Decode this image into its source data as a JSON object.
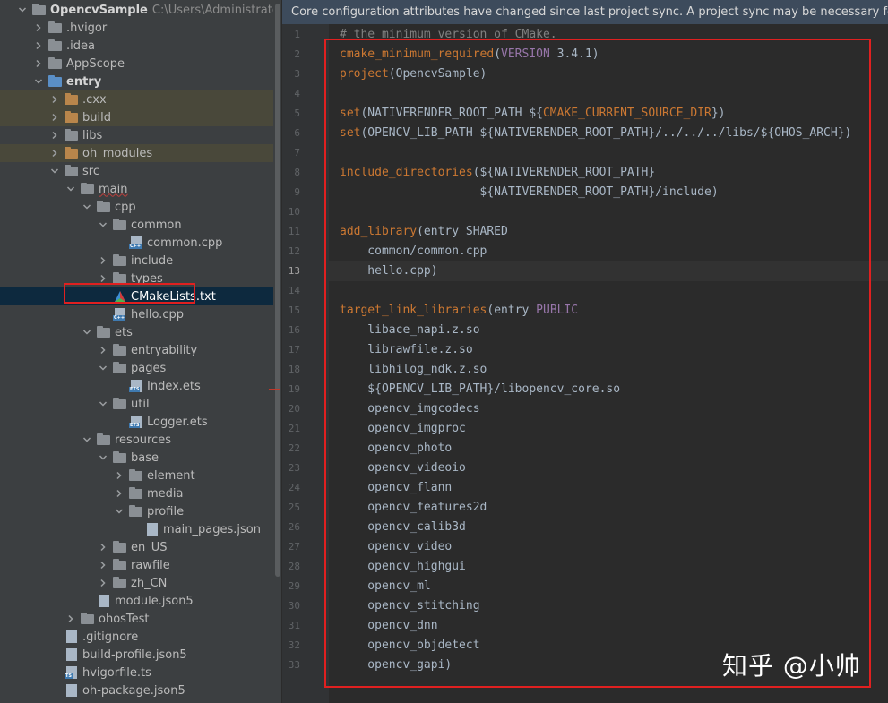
{
  "project_tree": {
    "rows": [
      {
        "label": "OpencvSample",
        "path": "C:\\Users\\Administrator\\DevEco",
        "bold": true,
        "chevron": "down",
        "icon": "folder",
        "indent": 0
      },
      {
        "label": ".hvigor",
        "chevron": "right",
        "icon": "folder",
        "indent": 1
      },
      {
        "label": ".idea",
        "chevron": "right",
        "icon": "folder",
        "indent": 1
      },
      {
        "label": "AppScope",
        "chevron": "right",
        "icon": "folder",
        "indent": 1
      },
      {
        "label": "entry",
        "bold": true,
        "chevron": "down",
        "icon": "folder-blue",
        "indent": 1
      },
      {
        "label": ".cxx",
        "chevron": "right",
        "icon": "folder-orange",
        "indent": 2,
        "excluded": true
      },
      {
        "label": "build",
        "chevron": "right",
        "icon": "folder-orange",
        "indent": 2,
        "excluded": true
      },
      {
        "label": "libs",
        "chevron": "right",
        "icon": "folder",
        "indent": 2
      },
      {
        "label": "oh_modules",
        "chevron": "right",
        "icon": "folder-orange",
        "indent": 2,
        "excluded": true
      },
      {
        "label": "src",
        "chevron": "down",
        "icon": "folder",
        "indent": 2
      },
      {
        "label": "main",
        "chevron": "down",
        "icon": "folder",
        "indent": 3,
        "squiggle": true
      },
      {
        "label": "cpp",
        "chevron": "down",
        "icon": "folder",
        "indent": 4
      },
      {
        "label": "common",
        "chevron": "down",
        "icon": "folder",
        "indent": 5
      },
      {
        "label": "common.cpp",
        "chevron": "none",
        "icon": "file-cpp",
        "indent": 6
      },
      {
        "label": "include",
        "chevron": "right",
        "icon": "folder",
        "indent": 5
      },
      {
        "label": "types",
        "chevron": "right",
        "icon": "folder",
        "indent": 5
      },
      {
        "label": "CMakeLists.txt",
        "chevron": "none",
        "icon": "file-cmake",
        "indent": 5,
        "selected": true
      },
      {
        "label": "hello.cpp",
        "chevron": "none",
        "icon": "file-cpp",
        "indent": 5
      },
      {
        "label": "ets",
        "chevron": "down",
        "icon": "folder",
        "indent": 4
      },
      {
        "label": "entryability",
        "chevron": "right",
        "icon": "folder",
        "indent": 5
      },
      {
        "label": "pages",
        "chevron": "down",
        "icon": "folder",
        "indent": 5
      },
      {
        "label": "Index.ets",
        "chevron": "none",
        "icon": "file-ets",
        "indent": 6
      },
      {
        "label": "util",
        "chevron": "down",
        "icon": "folder",
        "indent": 5
      },
      {
        "label": "Logger.ets",
        "chevron": "none",
        "icon": "file-ets",
        "indent": 6
      },
      {
        "label": "resources",
        "chevron": "down",
        "icon": "folder",
        "indent": 4
      },
      {
        "label": "base",
        "chevron": "down",
        "icon": "folder",
        "indent": 5
      },
      {
        "label": "element",
        "chevron": "right",
        "icon": "folder",
        "indent": 6
      },
      {
        "label": "media",
        "chevron": "right",
        "icon": "folder",
        "indent": 6
      },
      {
        "label": "profile",
        "chevron": "down",
        "icon": "folder",
        "indent": 6
      },
      {
        "label": "main_pages.json",
        "chevron": "none",
        "icon": "file-json",
        "indent": 7
      },
      {
        "label": "en_US",
        "chevron": "right",
        "icon": "folder",
        "indent": 5
      },
      {
        "label": "rawfile",
        "chevron": "right",
        "icon": "folder",
        "indent": 5
      },
      {
        "label": "zh_CN",
        "chevron": "right",
        "icon": "folder",
        "indent": 5
      },
      {
        "label": "module.json5",
        "chevron": "none",
        "icon": "file-json",
        "indent": 4
      },
      {
        "label": "ohosTest",
        "chevron": "right",
        "icon": "folder",
        "indent": 3
      },
      {
        "label": ".gitignore",
        "chevron": "none",
        "icon": "file-plain",
        "indent": 2
      },
      {
        "label": "build-profile.json5",
        "chevron": "none",
        "icon": "file-json",
        "indent": 2
      },
      {
        "label": "hvigorfile.ts",
        "chevron": "none",
        "icon": "file-ts",
        "indent": 2
      },
      {
        "label": "oh-package.json5",
        "chevron": "none",
        "icon": "file-json",
        "indent": 2
      }
    ]
  },
  "editor": {
    "banner": "Core configuration attributes have changed since last project sync. A project sync may be necessary for the IDE to",
    "current_line": 13,
    "lines": [
      [
        [
          "cmt",
          "# the minimum version of CMake."
        ]
      ],
      [
        [
          "fn",
          "cmake_minimum_required"
        ],
        [
          "pl",
          "("
        ],
        [
          "var",
          "VERSION"
        ],
        [
          "pl",
          " 3.4.1)"
        ]
      ],
      [
        [
          "fn",
          "project"
        ],
        [
          "pl",
          "(OpencvSample)"
        ]
      ],
      [],
      [
        [
          "fn",
          "set"
        ],
        [
          "pl",
          "(NATIVERENDER_ROOT_PATH ${"
        ],
        [
          "fn",
          "CMAKE_CURRENT_SOURCE_DIR"
        ],
        [
          "pl",
          "})"
        ]
      ],
      [
        [
          "fn",
          "set"
        ],
        [
          "pl",
          "(OPENCV_LIB_PATH ${NATIVERENDER_ROOT_PATH}/../../../libs/${OHOS_ARCH})"
        ]
      ],
      [],
      [
        [
          "fn",
          "include_directories"
        ],
        [
          "pl",
          "(${NATIVERENDER_ROOT_PATH}"
        ]
      ],
      [
        [
          "pl",
          "                    ${NATIVERENDER_ROOT_PATH}/include)"
        ]
      ],
      [],
      [
        [
          "fn",
          "add_library"
        ],
        [
          "pl",
          "(entry SHARED"
        ]
      ],
      [
        [
          "pl",
          "    common/common.cpp"
        ]
      ],
      [
        [
          "pl",
          "    hello.cpp)"
        ]
      ],
      [],
      [
        [
          "fn",
          "target_link_libraries"
        ],
        [
          "pl",
          "(entry "
        ],
        [
          "var",
          "PUBLIC"
        ]
      ],
      [
        [
          "pl",
          "    libace_napi.z.so"
        ]
      ],
      [
        [
          "pl",
          "    librawfile.z.so"
        ]
      ],
      [
        [
          "pl",
          "    libhilog_ndk.z.so"
        ]
      ],
      [
        [
          "pl",
          "    ${OPENCV_LIB_PATH}/libopencv_core.so"
        ]
      ],
      [
        [
          "pl",
          "    opencv_imgcodecs"
        ]
      ],
      [
        [
          "pl",
          "    opencv_imgproc"
        ]
      ],
      [
        [
          "pl",
          "    opencv_photo"
        ]
      ],
      [
        [
          "pl",
          "    opencv_videoio"
        ]
      ],
      [
        [
          "pl",
          "    opencv_flann"
        ]
      ],
      [
        [
          "pl",
          "    opencv_features2d"
        ]
      ],
      [
        [
          "pl",
          "    opencv_calib3d"
        ]
      ],
      [
        [
          "pl",
          "    opencv_video"
        ]
      ],
      [
        [
          "pl",
          "    opencv_highgui"
        ]
      ],
      [
        [
          "pl",
          "    opencv_ml"
        ]
      ],
      [
        [
          "pl",
          "    opencv_stitching"
        ]
      ],
      [
        [
          "pl",
          "    opencv_dnn"
        ]
      ],
      [
        [
          "pl",
          "    opencv_objdetect"
        ]
      ],
      [
        [
          "pl",
          "    opencv_gapi)"
        ]
      ]
    ]
  },
  "watermark": "知乎 @小帅",
  "colors": {
    "tree_bg": "#3c3f41",
    "editor_bg": "#2b2b2b",
    "gutter_bg": "#313335",
    "banner_bg": "#3d4b5c",
    "selection": "#0d293e",
    "excluded_bg": "#49483a",
    "keyword": "#cc7832",
    "variable": "#9876aa",
    "comment": "#808080",
    "text": "#a9b7c6",
    "highlight_box": "#e02020"
  }
}
